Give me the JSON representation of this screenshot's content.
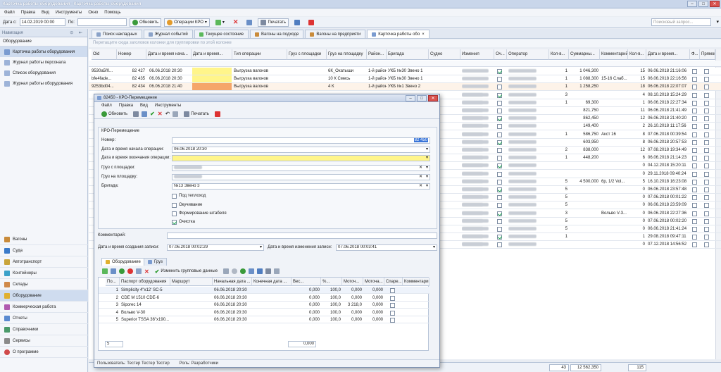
{
  "window": {
    "title": "Карточка работы оборудования - Карточка работы оборудования",
    "close": "✕"
  },
  "menu": [
    "Файл",
    "Правка",
    "Вид",
    "Инструменты",
    "Окно",
    "Помощь"
  ],
  "toolbar": {
    "date_label": "Дата с:",
    "date_value": "14.02.2019 00:00",
    "po_label": "По:",
    "refresh": "Обновить",
    "kpo": "Операции КРО",
    "print": "Печатать",
    "search_placeholder": "Поисковый запрос..."
  },
  "nav": {
    "header": "Навигация",
    "section": "Оборудование",
    "items": [
      "Карточка работы оборудования",
      "Журнал работы персонала",
      "Список оборудования",
      "Журнал работы оборудования"
    ],
    "modules": [
      "Вагоны",
      "Суда",
      "Автотранспорт",
      "Контейнеры",
      "Склады",
      "Оборудование",
      "Коммерческая работа",
      "Отчеты",
      "Справочники",
      "Сервисы",
      "О программе"
    ]
  },
  "tabs": [
    "Поиск накладных",
    "Журнал событий",
    "Текущее состояние",
    "Вагоны на подходе",
    "Вагоны на предприяти",
    "Карточка работы обо"
  ],
  "group_hint": "Перетащите сюда заголовок колонки для группировки по этой колонке",
  "columns": [
    "Oid",
    "Номер",
    "Дата и время нача...",
    "Дата и время...",
    "Тип операции",
    "Груз с площадки",
    "Груз на площадку",
    "Район...",
    "Бригада",
    "Судно",
    "Изменил",
    "Оч...",
    "Оператор",
    "Кол-в...",
    "Суммарны...",
    "Комментарий",
    "Кол-в...",
    "Дата и время...",
    "Ф...",
    "Прямой..."
  ],
  "rows": [
    {
      "oid": "9530a5f0...",
      "num": "82 427",
      "date": "06.06.2018 20:30",
      "color": "#fff58a",
      "type": "Выгрузка вагонов",
      "to": "6К_Окатыши",
      "raion": "1-й район",
      "brig": "УКБ №30 Звено 1",
      "k1": "1",
      "sum": "1 046,300",
      "comm": "",
      "k2": "15",
      "dt": "06.06.2018 21:16:06"
    },
    {
      "oid": "bfe4fade...",
      "num": "82 435",
      "date": "06.06.2018 20:30",
      "color": "#fff58a",
      "type": "Выгрузка вагонов",
      "to": "10 К Смесь",
      "raion": "1-й район",
      "brig": "УКБ №30 Звено 1",
      "k1": "1",
      "sum": "1 088,300",
      "comm": "15-16 Слаб...",
      "k2": "15",
      "dt": "06.06.2018 22:16:56"
    },
    {
      "oid": "9253bd04...",
      "num": "82 434",
      "date": "06.06.2018 21:40",
      "color": "#f5a66a",
      "type": "Выгрузка вагонов",
      "to": "4 К",
      "raion": "1-й район",
      "brig": "УКБ №1 Звено 2",
      "k1": "1",
      "sum": "1 258,250",
      "comm": "",
      "k2": "18",
      "dt": "06.06.2018 22:07:07"
    },
    {
      "k1": "3",
      "sum": "",
      "comm": "",
      "k2": "4",
      "dt": "08.10.2018 15:24:29"
    },
    {
      "k1": "1",
      "sum": "69,300",
      "comm": "",
      "k2": "1",
      "dt": "06.06.2018 22:27:34"
    },
    {
      "k1": "",
      "sum": "821,750",
      "comm": "",
      "k2": "11",
      "dt": "06.06.2018 21:41:49"
    },
    {
      "k1": "",
      "sum": "862,450",
      "comm": "",
      "k2": "12",
      "dt": "06.06.2018 21:40:20"
    },
    {
      "k1": "",
      "sum": "149,400",
      "comm": "",
      "k2": "2",
      "dt": "26.10.2018 11:17:56"
    },
    {
      "k1": "1",
      "sum": "586,750",
      "comm": "Акст 16",
      "k2": "8",
      "dt": "07.06.2018 00:39:54"
    },
    {
      "k1": "",
      "sum": "603,950",
      "comm": "",
      "k2": "8",
      "dt": "06.06.2018 20:57:53"
    },
    {
      "k1": "2",
      "sum": "838,000",
      "comm": "",
      "k2": "12",
      "dt": "07.08.2018 19:34:49"
    },
    {
      "k1": "1",
      "sum": "448,200",
      "comm": "",
      "k2": "6",
      "dt": "06.06.2018 21:14:23"
    },
    {
      "k1": "",
      "sum": "",
      "comm": "",
      "k2": "0",
      "dt": "04.12.2018 15:20:11"
    },
    {
      "k1": "",
      "sum": "",
      "comm": "",
      "k2": "0",
      "dt": "29.11.2018 09:40:24"
    },
    {
      "k1": "5",
      "sum": "4 500,000",
      "comm": "6р, 1/2 Vol...",
      "k2": "5",
      "dt": "16.10.2018 16:23:08"
    },
    {
      "k1": "5",
      "sum": "",
      "comm": "",
      "k2": "0",
      "dt": "06.06.2018 23:57:48"
    },
    {
      "k1": "5",
      "sum": "",
      "comm": "",
      "k2": "0",
      "dt": "07.06.2018 00:01:22"
    },
    {
      "k1": "5",
      "sum": "",
      "comm": "",
      "k2": "0",
      "dt": "06.06.2018 23:59:09"
    },
    {
      "k1": "3",
      "sum": "",
      "comm": "Вольво V-3...",
      "k2": "0",
      "dt": "06.06.2018 22:27:36"
    },
    {
      "k1": "5",
      "sum": "",
      "comm": "",
      "k2": "0",
      "dt": "07.06.2018 00:02:20"
    },
    {
      "k1": "5",
      "sum": "",
      "comm": "",
      "k2": "0",
      "dt": "06.06.2018 21:41:24"
    },
    {
      "k1": "1",
      "sum": "",
      "comm": "",
      "k2": "1",
      "dt": "29.08.2018 09:47:11"
    },
    {
      "k1": "",
      "sum": "",
      "comm": "",
      "k2": "0",
      "dt": "07.12.2018 14:56:52"
    }
  ],
  "totals": {
    "count": "43",
    "sum": "12 562,350",
    "k2": "115"
  },
  "dialog": {
    "title": "82450 - КРО-Перемещение",
    "menu": [
      "Файл",
      "Правка",
      "Вид",
      "Инструменты"
    ],
    "refresh": "Обновить",
    "print": "Печатать",
    "group": "КРО-Перемещение",
    "labels": {
      "num": "Номер:",
      "start": "Дата и время начала операции:",
      "end": "Дата и время окончания операции:",
      "from": "Груз с площадки:",
      "to": "Груз на площадку:",
      "brig": "Бригада:",
      "comment": "Комментарий:",
      "created": "Дата и время создания записи:",
      "changed": "Дата и время изменения записи:"
    },
    "values": {
      "num": "82 450",
      "start": "06.06.2018 20:30",
      "end": "",
      "brig": "№13 Звено 3",
      "created": "07.06.2018 00:02:29",
      "changed": "07.06.2018 00:03:41"
    },
    "checks": [
      {
        "label": "Под теплоход",
        "on": false
      },
      {
        "label": "Окучивание",
        "on": false
      },
      {
        "label": "Формирование штабеля",
        "on": false
      },
      {
        "label": "Очистка",
        "on": true
      }
    ],
    "tabs": [
      "Оборудование",
      "Груз"
    ],
    "inner_tb": "Изменить групповые данные",
    "icols": [
      "По...",
      "Паспорт оборудования",
      "Маршрут",
      "Начальная дата ...",
      "Конечная дата ...",
      "Вес...",
      "%...",
      "Моточ...",
      "Моточа...",
      "Спаре...",
      "Комментарий"
    ],
    "irows": [
      {
        "n": "1",
        "p": "Simplicity 4\"x12' SC-5",
        "s": "06.06.2018 20:30",
        "w": "0,000",
        "pc": "100,0",
        "m1": "0,000",
        "m2": "0,000"
      },
      {
        "n": "2",
        "p": "CDE M 1510 CDE-6",
        "s": "06.06.2018 20:30",
        "w": "0,000",
        "pc": "100,0",
        "m1": "0,000",
        "m2": "0,000"
      },
      {
        "n": "3",
        "p": "Siporec 14",
        "s": "06.06.2018 20:30",
        "w": "0,000",
        "pc": "100,0",
        "m1": "3 218,0",
        "m2": "0,000"
      },
      {
        "n": "4",
        "p": "Вольво V-30",
        "s": "06.06.2018 20:30",
        "w": "0,000",
        "pc": "100,0",
        "m1": "0,000",
        "m2": "0,000"
      },
      {
        "n": "5",
        "p": "Superior TSSA 36\"x190...",
        "s": "06.06.2018 20:30",
        "w": "0,000",
        "pc": "100,0",
        "m1": "0,000",
        "m2": "0,000"
      }
    ],
    "ifoot_count": "5",
    "ifoot_w": "0,000",
    "status_user": "Пользователь: Тестер Тестер Тестер",
    "status_role": "Роль: Разработчики"
  }
}
